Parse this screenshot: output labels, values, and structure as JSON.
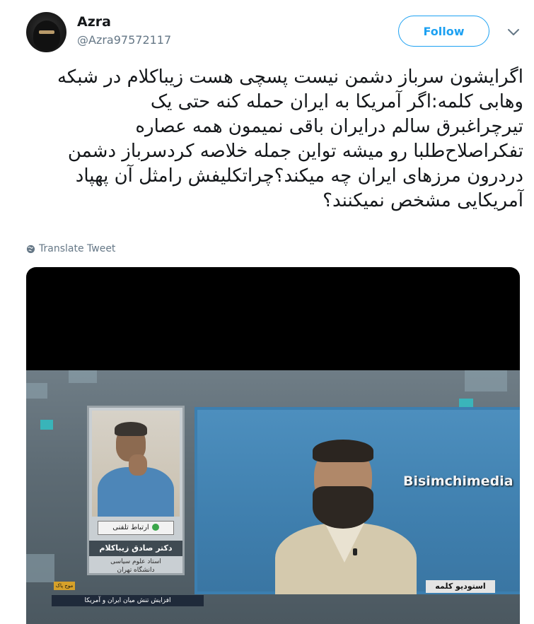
{
  "author": {
    "name": "Azra",
    "handle": "@Azra97572117"
  },
  "actions": {
    "follow_label": "Follow"
  },
  "tweet": {
    "lines": [
      "اگرایشون سرباز دشمن نیست پسچی هست زیباکلام در شبکه",
      "وهابی کلمه:اگر آمریکا به ایران حمله کنه حتی یک",
      "تیرچراغبرق سالم درایران باقی نمیمون همه عصاره",
      "تفکراصلاح‌طلبا رو میشه تواین جمله خلاصه کردسرباز دشمن",
      "دردرون مرزهای ایران چه میکند؟چراتکلیفش رامثل آن پهپاد",
      "آمریکایی مشخص نمیکنند؟"
    ],
    "translate_label": "Translate Tweet"
  },
  "media": {
    "watermark": "Bisimchimedia",
    "phone_badge": "ارتباط تلفنی",
    "guest_name": "دکتر صادق زیباکلام",
    "guest_title_1": "استاد علوم سیاسی",
    "guest_title_2": "دانشگاه تهران",
    "studio_label": "استودیو کلمه",
    "ticker_tag": "موج پاک",
    "ticker_text": "افزایش تنش میان ایران و آمریکا"
  }
}
